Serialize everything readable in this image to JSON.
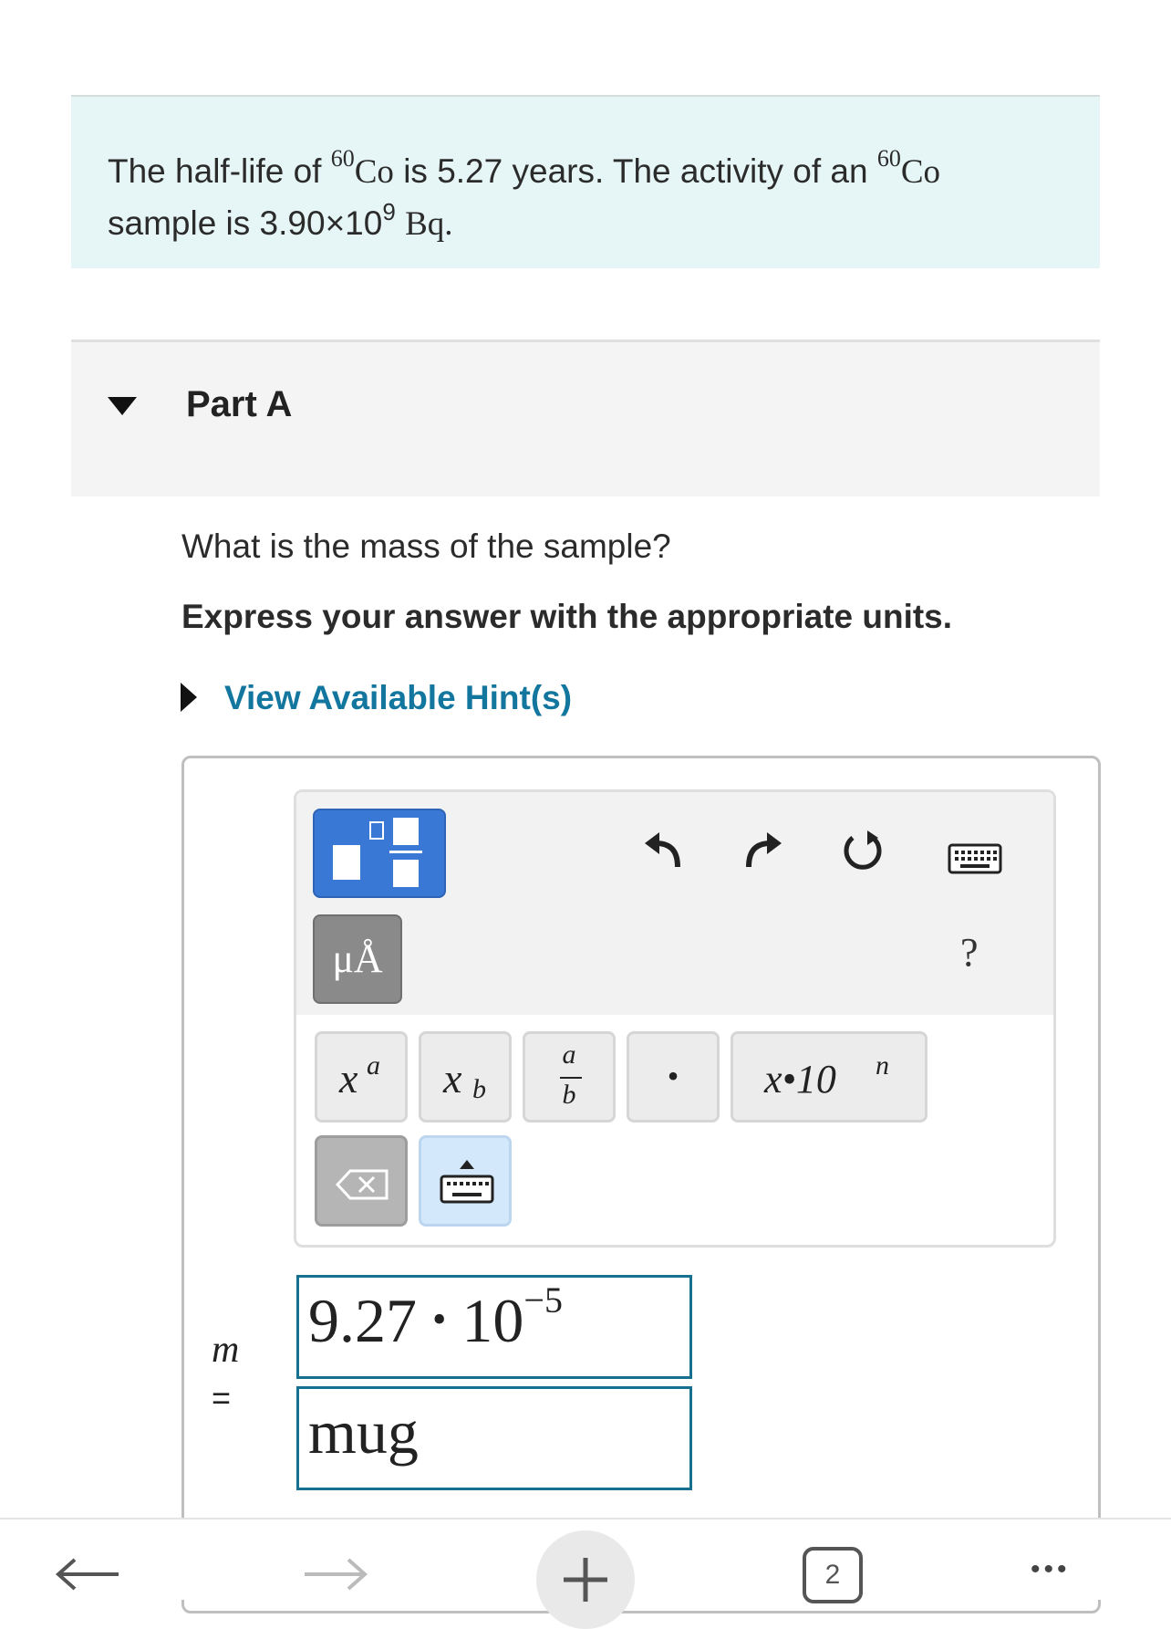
{
  "problem": {
    "text_1": "The half-life of ",
    "isotope_mass": "60",
    "element": "Co",
    "text_2": " is 5.27 years. The activity of an ",
    "text_3": "sample is 3.90×10",
    "exponent": "9",
    "unit": "Bq",
    "period": "."
  },
  "part": {
    "title": "Part A",
    "question": "What is the mass of the sample?",
    "instruction": "Express your answer with the appropriate units.",
    "hint_link": "View Available Hint(s)"
  },
  "toolbar": {
    "units_label": "μÅ",
    "help_label": "?",
    "keys": {
      "superscript_base": "x",
      "superscript_exp": "a",
      "subscript_base": "x",
      "subscript_sub": "b",
      "fraction_num": "a",
      "fraction_den": "b",
      "dot": "•",
      "sci_base": "x",
      "sci_mid": "•10",
      "sci_exp": "n"
    }
  },
  "answer": {
    "variable": "m",
    "equals": "=",
    "value_mantissa": "9.27",
    "value_dot": "•",
    "value_base": "10",
    "value_exponent": "−5",
    "unit_value": "mug"
  },
  "browser": {
    "tab_count": "2",
    "menu_dots": "•••"
  },
  "icons": [
    "collapse-caret-icon",
    "expand-caret-icon",
    "undo-icon",
    "redo-icon",
    "reset-icon",
    "keyboard-icon",
    "backspace-icon",
    "back-arrow-icon",
    "forward-arrow-icon",
    "plus-icon"
  ]
}
